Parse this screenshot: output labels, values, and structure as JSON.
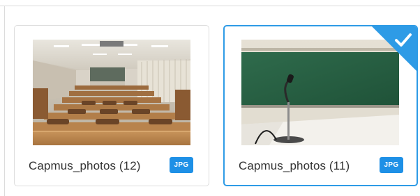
{
  "items": [
    {
      "title": "Capmus_photos (12)",
      "format_badge": "JPG",
      "selected": false,
      "image": "lecture-hall-desks-photo"
    },
    {
      "title": "Capmus_photos (11)",
      "format_badge": "JPG",
      "selected": true,
      "image": "classroom-chalkboard-microphone-photo"
    }
  ],
  "colors": {
    "accent": "#2e9be6",
    "badge": "#1e90e6",
    "text": "#333333",
    "border": "#dcdcdc"
  },
  "icons": {
    "selected_indicator": "checkmark-icon"
  }
}
